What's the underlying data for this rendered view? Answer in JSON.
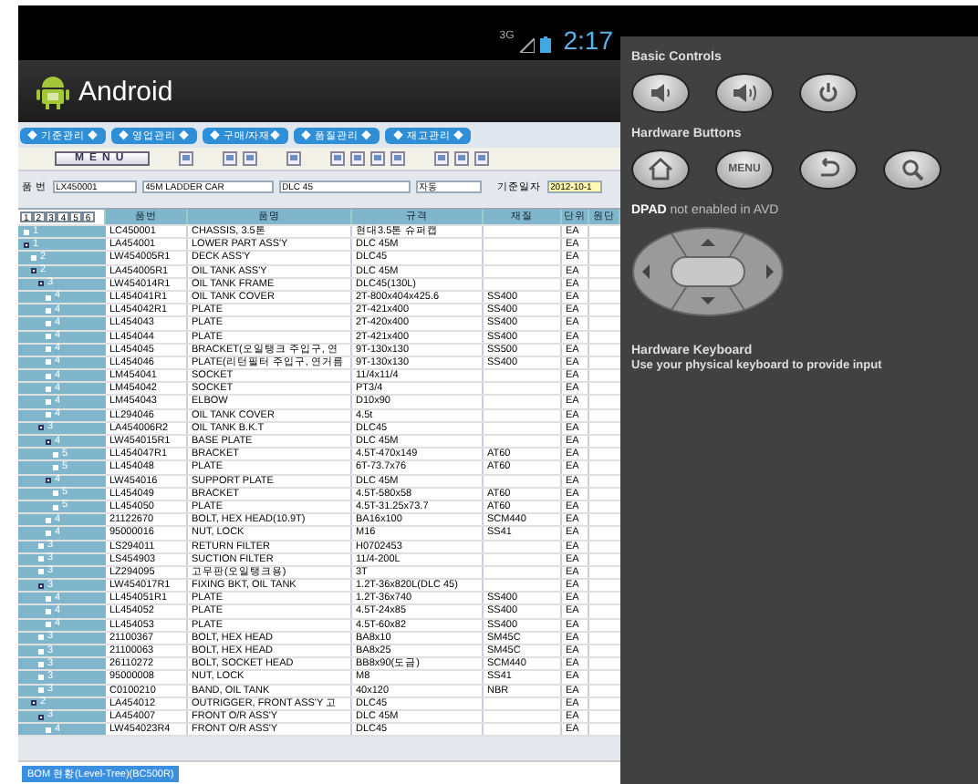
{
  "status_bar": {
    "network": "3G",
    "time": "2:17"
  },
  "title_bar": {
    "title": "Android"
  },
  "menu_tabs": [
    {
      "label": "◆ 기준관리 ◆"
    },
    {
      "label": "◆ 영업관리 ◆"
    },
    {
      "label": "◆ 구매/자재◆"
    },
    {
      "label": "◆ 품질관리 ◆"
    },
    {
      "label": "◆ 재고관리 ◆"
    }
  ],
  "toolbar": {
    "menu_button": "MENU"
  },
  "search": {
    "label": "품 번",
    "part_no": "LX450001",
    "name": "45M LADDER CAR",
    "spec": "DLC 45",
    "type": "자동",
    "date_label": "기준일자",
    "date": "2012-10-1"
  },
  "table": {
    "level_tabs": [
      "1",
      "2",
      "3",
      "4",
      "5",
      "6"
    ],
    "columns": [
      "품번",
      "품명",
      "규격",
      "재질",
      "단위",
      "원단"
    ],
    "rows": [
      {
        "level": "1",
        "part_no": "LC450001",
        "name": "CHASSIS, 3.5톤",
        "spec": "현대3.5톤 슈퍼캡",
        "unit": "EA"
      },
      {
        "level": "1",
        "part_no": "LA454001",
        "name": "LOWER PART ASS'Y",
        "spec": "DLC 45M",
        "unit": "EA",
        "children": [
          {
            "level": "2",
            "part_no": "LW454005R1",
            "name": "DECK ASS'Y",
            "spec": "DLC45",
            "unit": "EA"
          },
          {
            "level": "2",
            "part_no": "LA454005R1",
            "name": "OIL TANK ASS'Y",
            "spec": "DLC 45M",
            "unit": "EA",
            "children": [
              {
                "level": "3",
                "part_no": "LW454014R1",
                "name": "OIL TANK FRAME",
                "spec": "DLC45(130L)",
                "unit": "EA",
                "children": [
                  {
                    "level": "4",
                    "part_no": "LL454041R1",
                    "name": "OIL TANK COVER",
                    "spec": "2T-800x404x425.6",
                    "material": "SS400",
                    "unit": "EA"
                  },
                  {
                    "level": "4",
                    "part_no": "LL454042R1",
                    "name": "PLATE",
                    "spec": "2T-421x400",
                    "material": "SS400",
                    "unit": "EA"
                  },
                  {
                    "level": "4",
                    "part_no": "LL454043",
                    "name": "PLATE",
                    "spec": "2T-420x400",
                    "material": "SS400",
                    "unit": "EA"
                  },
                  {
                    "level": "4",
                    "part_no": "LL454044",
                    "name": "PLATE",
                    "spec": "2T-421x400",
                    "material": "SS400",
                    "unit": "EA"
                  },
                  {
                    "level": "4",
                    "part_no": "LL454045",
                    "name": "BRACKET(오일탱크 주입구, 연",
                    "spec": "9T-130x130",
                    "material": "SS500",
                    "unit": "EA"
                  },
                  {
                    "level": "4",
                    "part_no": "LL454046",
                    "name": "PLATE(리턴필터 주입구, 연거름",
                    "spec": "9T-130x130",
                    "material": "SS400",
                    "unit": "EA"
                  },
                  {
                    "level": "4",
                    "part_no": "LM454041",
                    "name": "SOCKET",
                    "spec": "11/4x11/4",
                    "unit": "EA"
                  },
                  {
                    "level": "4",
                    "part_no": "LM454042",
                    "name": "SOCKET",
                    "spec": "PT3/4",
                    "unit": "EA"
                  },
                  {
                    "level": "4",
                    "part_no": "LM454043",
                    "name": "ELBOW",
                    "spec": "D10x90",
                    "unit": "EA"
                  },
                  {
                    "level": "4",
                    "part_no": "LL294046",
                    "name": "OIL TANK COVER",
                    "spec": "4.5t",
                    "unit": "EA"
                  }
                ]
              },
              {
                "level": "3",
                "part_no": "LA454006R2",
                "name": "OIL TANK B.K.T",
                "spec": "DLC45",
                "unit": "EA",
                "children": [
                  {
                    "level": "4",
                    "part_no": "LW454015R1",
                    "name": "BASE PLATE",
                    "spec": "DLC 45M",
                    "unit": "EA",
                    "children": [
                      {
                        "level": "5",
                        "part_no": "LL454047R1",
                        "name": "BRACKET",
                        "spec": "4.5T-470x149",
                        "material": "AT60",
                        "unit": "EA"
                      },
                      {
                        "level": "5",
                        "part_no": "LL454048",
                        "name": "PLATE",
                        "spec": "6T-73.7x76",
                        "material": "AT60",
                        "unit": "EA"
                      }
                    ]
                  },
                  {
                    "level": "4",
                    "part_no": "LW454016",
                    "name": "SUPPORT PLATE",
                    "spec": "DLC 45M",
                    "unit": "EA",
                    "children": [
                      {
                        "level": "5",
                        "part_no": "LL454049",
                        "name": "BRACKET",
                        "spec": "4.5T-580x58",
                        "material": "AT60",
                        "unit": "EA"
                      },
                      {
                        "level": "5",
                        "part_no": "LL454050",
                        "name": "PLATE",
                        "spec": "4.5T-31.25x73.7",
                        "material": "AT60",
                        "unit": "EA"
                      }
                    ]
                  },
                  {
                    "level": "4",
                    "part_no": "21122670",
                    "name": "BOLT, HEX HEAD(10.9T)",
                    "spec": "BA16x100",
                    "material": "SCM440",
                    "unit": "EA"
                  },
                  {
                    "level": "4",
                    "part_no": "95000016",
                    "name": "NUT, LOCK",
                    "spec": "M16",
                    "material": "SS41",
                    "unit": "EA"
                  }
                ]
              },
              {
                "level": "3",
                "part_no": "LS294011",
                "name": "RETURN FILTER",
                "spec": "H0702453",
                "unit": "EA"
              },
              {
                "level": "3",
                "part_no": "LS454903",
                "name": "SUCTION FILTER",
                "spec": "11/4-200L",
                "unit": "EA"
              },
              {
                "level": "3",
                "part_no": "LZ294095",
                "name": "고무판(오일탱크용)",
                "spec": "3T",
                "unit": "EA"
              },
              {
                "level": "3",
                "part_no": "LW454017R1",
                "name": "FIXING BKT, OIL TANK",
                "spec": "1.2T-36x820L(DLC 45)",
                "unit": "EA",
                "children": [
                  {
                    "level": "4",
                    "part_no": "LL454051R1",
                    "name": "PLATE",
                    "spec": "1.2T-36x740",
                    "material": "SS400",
                    "unit": "EA"
                  },
                  {
                    "level": "4",
                    "part_no": "LL454052",
                    "name": "PLATE",
                    "spec": "4.5T-24x85",
                    "material": "SS400",
                    "unit": "EA"
                  },
                  {
                    "level": "4",
                    "part_no": "LL454053",
                    "name": "PLATE",
                    "spec": "4.5T-60x82",
                    "material": "SS400",
                    "unit": "EA"
                  }
                ]
              },
              {
                "level": "3",
                "part_no": "21100367",
                "name": "BOLT, HEX HEAD",
                "spec": "BA8x10",
                "material": "SM45C",
                "unit": "EA"
              },
              {
                "level": "3",
                "part_no": "21100063",
                "name": "BOLT, HEX HEAD",
                "spec": "BA8x25",
                "material": "SM45C",
                "unit": "EA"
              },
              {
                "level": "3",
                "part_no": "26110272",
                "name": "BOLT, SOCKET HEAD",
                "spec": "BB8x90(도금)",
                "material": "SCM440",
                "unit": "EA"
              },
              {
                "level": "3",
                "part_no": "95000008",
                "name": "NUT, LOCK",
                "spec": "M8",
                "material": "SS41",
                "unit": "EA"
              },
              {
                "level": "3",
                "part_no": "C0100210",
                "name": "BAND, OIL TANK",
                "spec": "40x120",
                "material": "NBR",
                "unit": "EA"
              }
            ]
          },
          {
            "level": "2",
            "part_no": "LA454012",
            "name": "OUTRIGGER, FRONT ASS'Y 고",
            "spec": "DLC45",
            "unit": "EA",
            "children": [
              {
                "level": "3",
                "part_no": "LA454007",
                "name": "FRONT O/R ASS'Y",
                "spec": "DLC 45M",
                "unit": "EA",
                "children": [
                  {
                    "level": "4",
                    "part_no": "LW454023R4",
                    "name": "FRONT O/R ASS'Y",
                    "spec": "DLC45",
                    "unit": "EA"
                  }
                ]
              }
            ]
          }
        ]
      }
    ]
  },
  "taskbar": {
    "window_tab": "BOM 현황(Level-Tree)(BC500R)"
  },
  "controls_panel": {
    "basic_title": "Basic Controls",
    "basic_buttons": [
      {
        "kind": "volume-down"
      },
      {
        "kind": "volume-up"
      },
      {
        "kind": "power"
      }
    ],
    "hardware_title": "Hardware Buttons",
    "hardware_buttons": [
      {
        "kind": "home"
      },
      {
        "kind": "menu",
        "label": "MENU"
      },
      {
        "kind": "back"
      },
      {
        "kind": "search"
      }
    ],
    "dpad_note": "**DPAD** not enabled in AVD",
    "keyboard_title": "Hardware Keyboard",
    "keyboard_note": "Use your physical keyboard to provide input"
  }
}
